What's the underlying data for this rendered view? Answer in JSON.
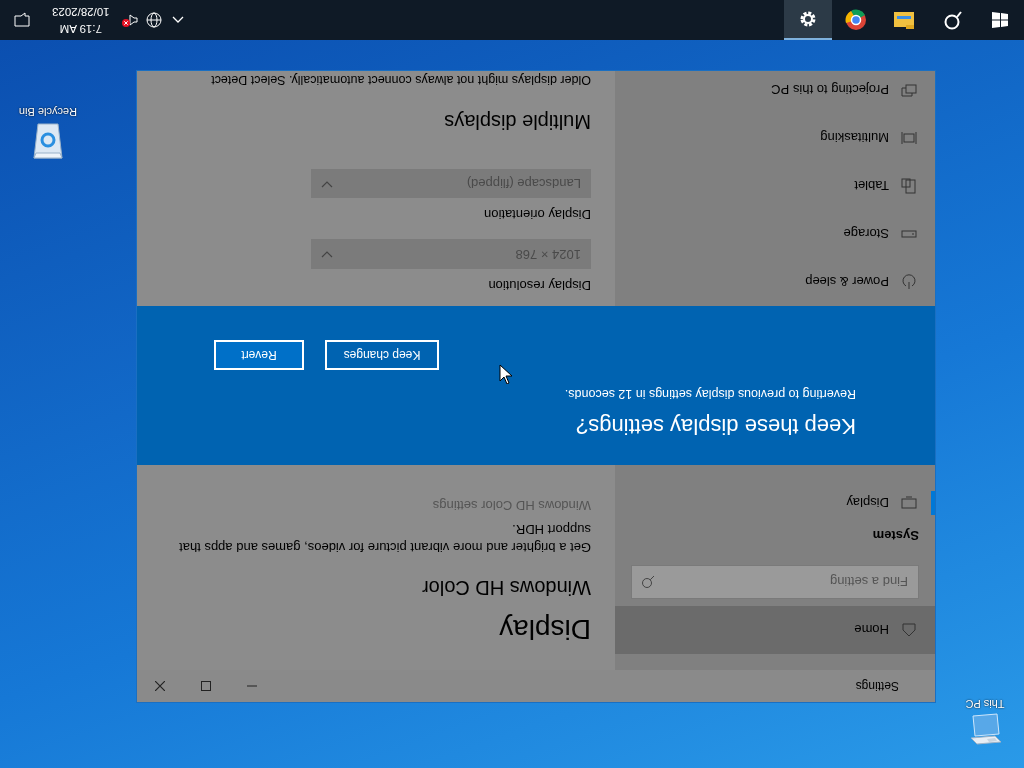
{
  "desktop": {
    "icons": [
      {
        "label": "This PC",
        "kind": "computer"
      },
      {
        "label": "Recycle Bin",
        "kind": "recycle-bin"
      }
    ]
  },
  "window": {
    "title": "Settings",
    "dimmed": true,
    "sidebar": {
      "home": {
        "label": "Home",
        "hovered": true
      },
      "search": {
        "placeholder": "Find a setting"
      },
      "section": "System",
      "items_above": [
        {
          "label": "Display",
          "kind": "display",
          "selected": true
        }
      ],
      "items_below": [
        {
          "label": "Power & sleep",
          "kind": "power",
          "selected": false
        },
        {
          "label": "Storage",
          "kind": "storage",
          "selected": false
        },
        {
          "label": "Tablet",
          "kind": "tablet",
          "selected": false
        },
        {
          "label": "Multitasking",
          "kind": "multitasking",
          "selected": false
        },
        {
          "label": "Projecting to this PC",
          "kind": "projecting",
          "selected": false
        }
      ]
    },
    "content": {
      "heading": "Display",
      "hd_color": {
        "title": "Windows HD Color",
        "description": "Get a brighter and more vibrant picture for videos, games and apps that support HDR.",
        "link": "Windows HD Color settings"
      },
      "resolution": {
        "label": "Display resolution",
        "value": "1024 × 768"
      },
      "orientation": {
        "label": "Display orientation",
        "value": "Landscape (flipped)"
      },
      "multiple_displays": {
        "title": "Multiple displays",
        "text": "Older displays might not always connect automatically. Select Detect"
      }
    },
    "dialog": {
      "title": "Keep these display settings?",
      "message": "Reverting to previous display settings in 12 seconds.",
      "buttons": [
        "Keep changes",
        "Revert"
      ]
    }
  },
  "taskbar": {
    "apps": [
      {
        "kind": "search",
        "selected": false
      },
      {
        "kind": "folder",
        "selected": false
      },
      {
        "kind": "browser",
        "selected": false
      },
      {
        "kind": "settings",
        "selected": true
      }
    ],
    "tray": {
      "volume_error": true,
      "time": "7:19 AM",
      "date": "10/28/2023"
    }
  }
}
